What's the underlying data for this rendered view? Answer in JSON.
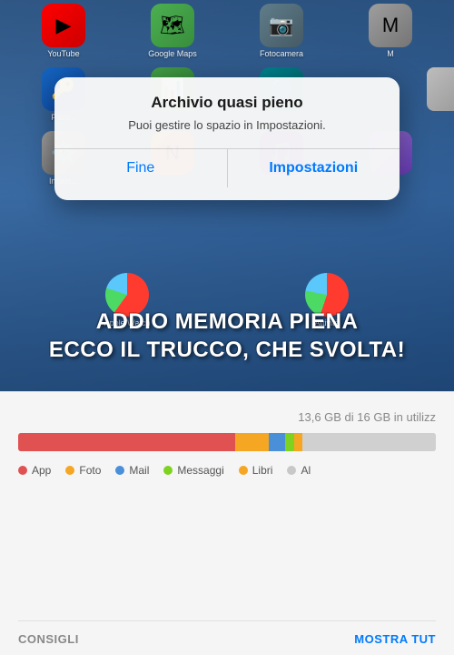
{
  "phone": {
    "top_apps": [
      {
        "label": "YouTube",
        "icon_class": "icon-youtube",
        "emoji": "▶"
      },
      {
        "label": "Google Maps",
        "icon_class": "icon-maps",
        "emoji": "📍"
      },
      {
        "label": "Fotocamera",
        "icon_class": "icon-camera",
        "emoji": "📷"
      },
      {
        "label": "M",
        "icon_class": "icon-mystery",
        "emoji": "M"
      }
    ],
    "row2_apps": [
      {
        "label": "Pass...",
        "icon_class": "icon-pass",
        "emoji": "🔑"
      },
      {
        "label": "",
        "icon_class": "icon-green",
        "emoji": ""
      },
      {
        "label": "",
        "icon_class": "icon-n3",
        "emoji": ""
      }
    ],
    "row3_apps": [
      {
        "label": "Impos...",
        "icon_class": "icon-impost",
        "emoji": "⚙"
      },
      {
        "label": "N",
        "icon_class": "icon-n1",
        "emoji": "N"
      },
      {
        "label": "",
        "icon_class": "icon-n2",
        "emoji": ""
      }
    ],
    "bottom_app_labels": [
      {
        "label": "Apple Watch"
      },
      {
        "label": "Attività"
      }
    ]
  },
  "dialog": {
    "title": "Archivio quasi pieno",
    "message": "Puoi gestire lo spazio in Impostazioni.",
    "btn_cancel": "Fine",
    "btn_action": "Impostazioni"
  },
  "hero": {
    "line1": "ADDIO MEMORIA PIENA",
    "line2": "ECCO IL TRUCCO, CHE SVOLTA!"
  },
  "storage": {
    "header": "13,6 GB di 16 GB in utilizz",
    "bar_segments": [
      {
        "color": "#e05252",
        "width_pct": 52,
        "label": "App"
      },
      {
        "color": "#f5a623",
        "width_pct": 8,
        "label": "Foto"
      },
      {
        "color": "#4a90d9",
        "width_pct": 4,
        "label": "Mail"
      },
      {
        "color": "#7ed321",
        "width_pct": 2,
        "label": "Messaggi"
      },
      {
        "color": "#f5a623",
        "width_pct": 2,
        "label": "Libri"
      },
      {
        "color": "#d0d0d0",
        "width_pct": 32,
        "label": ""
      }
    ],
    "legend": [
      {
        "color": "#e05252",
        "label": "App"
      },
      {
        "color": "#f5a623",
        "label": "Foto"
      },
      {
        "color": "#4a90d9",
        "label": "Mail"
      },
      {
        "color": "#7ed321",
        "label": "Messaggi"
      },
      {
        "color": "#f5a623",
        "label": "Libri"
      },
      {
        "color": "#c8c8c8",
        "label": "Al"
      }
    ],
    "footer_left": "CONSIGLI",
    "footer_right": "MOSTRA TUT"
  }
}
